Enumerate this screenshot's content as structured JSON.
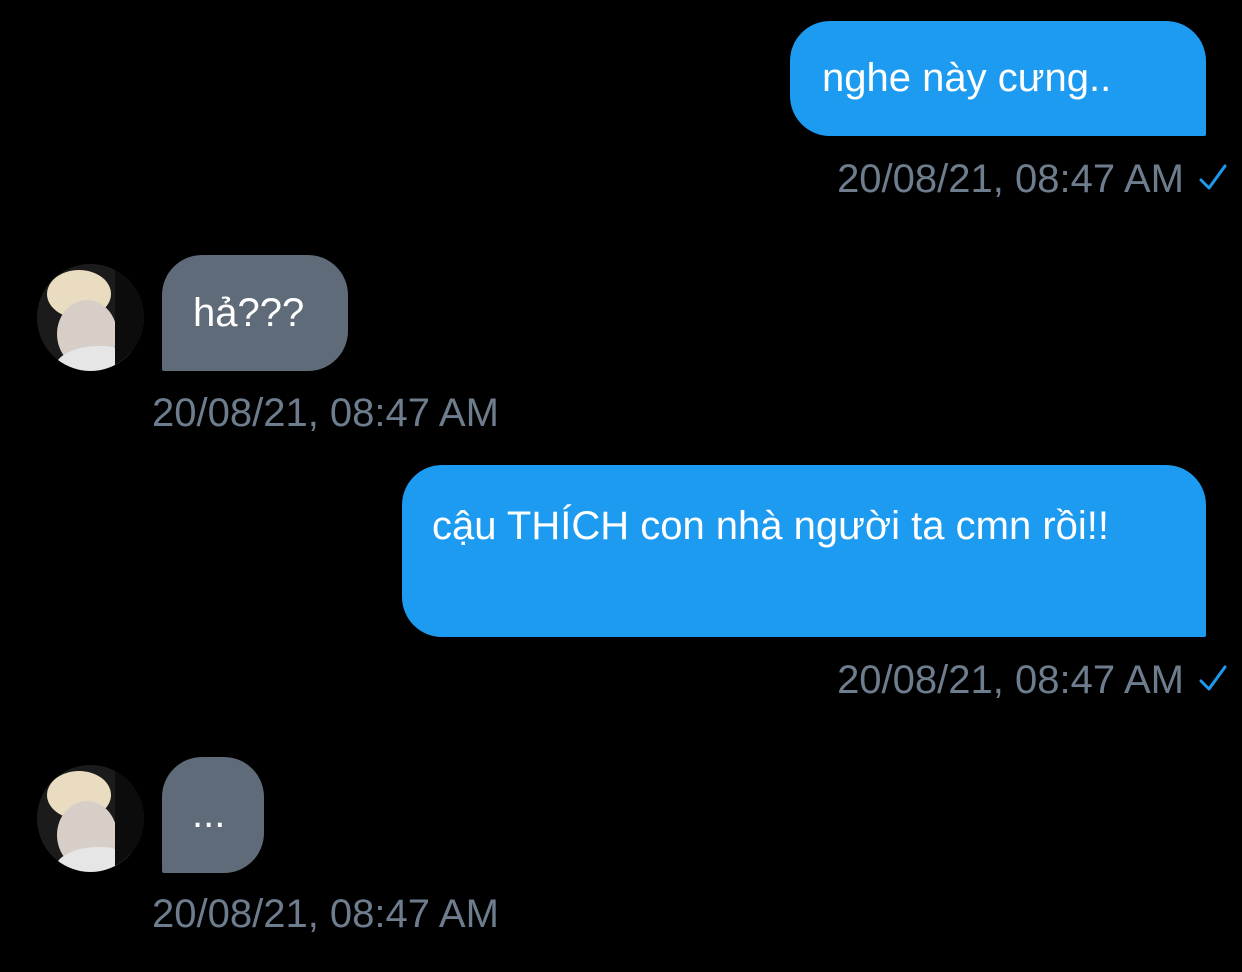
{
  "colors": {
    "background": "#000000",
    "sent_bubble": "#1d9bf0",
    "received_bubble": "#5f6b78",
    "timestamp": "#6e7d8d",
    "read_check": "#1d9bf0"
  },
  "messages": [
    {
      "direction": "sent",
      "text": "nghe này cưng..",
      "timestamp": "20/08/21, 08:47 AM",
      "status_icon": "check-icon"
    },
    {
      "direction": "received",
      "text": "hả???",
      "timestamp": "20/08/21, 08:47 AM",
      "avatar_icon": "avatar-icon"
    },
    {
      "direction": "sent",
      "text": "cậu THÍCH con nhà người ta cmn rồi!!",
      "timestamp": "20/08/21, 08:47 AM",
      "status_icon": "check-icon"
    },
    {
      "direction": "received",
      "text": "...",
      "timestamp": "20/08/21, 08:47 AM",
      "avatar_icon": "avatar-icon"
    }
  ]
}
